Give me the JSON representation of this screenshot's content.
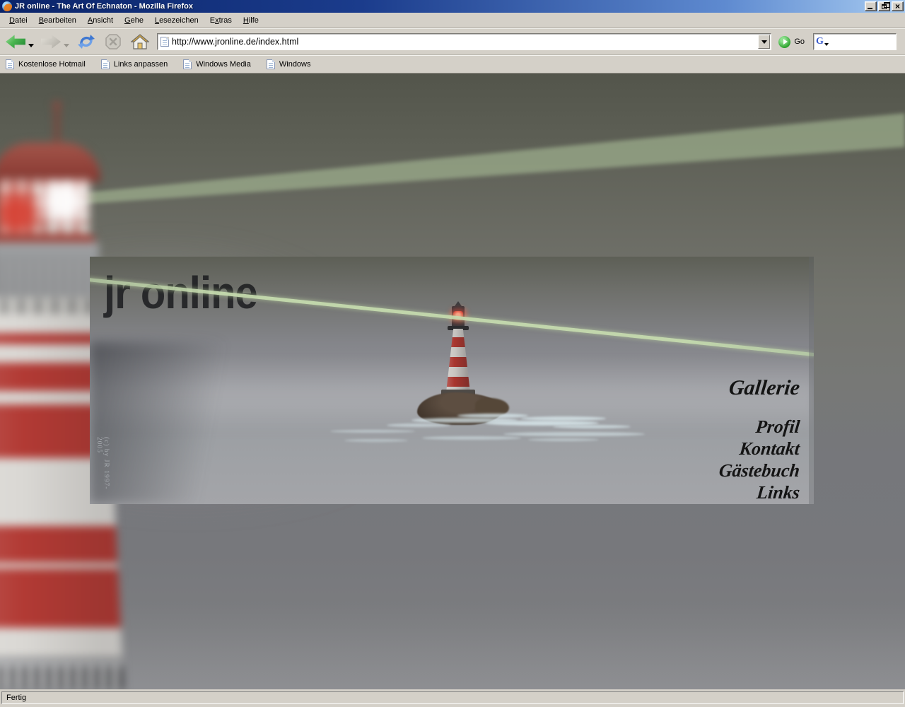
{
  "window": {
    "title": "JR online - The Art Of Echnaton - Mozilla Firefox"
  },
  "menu_bar": {
    "items": [
      {
        "label": "Datei",
        "accel": 0
      },
      {
        "label": "Bearbeiten",
        "accel": 0
      },
      {
        "label": "Ansicht",
        "accel": 0
      },
      {
        "label": "Gehe",
        "accel": 0
      },
      {
        "label": "Lesezeichen",
        "accel": 0
      },
      {
        "label": "Extras",
        "accel": 1
      },
      {
        "label": "Hilfe",
        "accel": 0
      }
    ]
  },
  "toolbar": {
    "url": "http://www.jronline.de/index.html",
    "go_label": "Go",
    "search_value": ""
  },
  "bookmarks_bar": {
    "items": [
      "Kostenlose Hotmail",
      "Links anpassen",
      "Windows Media",
      "Windows"
    ]
  },
  "page": {
    "logo": "jr online",
    "copyright": "(c) by JR 1997-2005",
    "nav": {
      "items": [
        "Gallerie",
        "Profil",
        "Kontakt",
        "Gästebuch",
        "Links"
      ]
    },
    "colors": {
      "beam_green": "#b7cfa0",
      "sky_top": "#595b51",
      "fog_gray": "#9d9ea2",
      "lighthouse_red": "#a8362f"
    }
  },
  "status_bar": {
    "text": "Fertig"
  }
}
